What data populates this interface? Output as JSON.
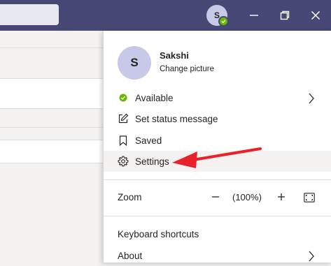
{
  "titlebar": {
    "avatar_initial": "S",
    "status_color": "#6bb700",
    "brand_color": "#464775",
    "icons": [
      "minimize-icon",
      "maximize-icon",
      "close-icon"
    ]
  },
  "profile": {
    "initial": "S",
    "name": "Sakshi",
    "change_picture": "Change picture"
  },
  "menu": {
    "available": "Available",
    "set_status": "Set status message",
    "saved": "Saved",
    "settings": "Settings"
  },
  "zoom": {
    "label": "Zoom",
    "minus": "−",
    "value": "(100%)",
    "plus": "+"
  },
  "footer": {
    "keyboard_shortcuts": "Keyboard shortcuts",
    "about": "About"
  },
  "annotation": {
    "arrow_color": "#e8212b",
    "points_to": "settings"
  }
}
